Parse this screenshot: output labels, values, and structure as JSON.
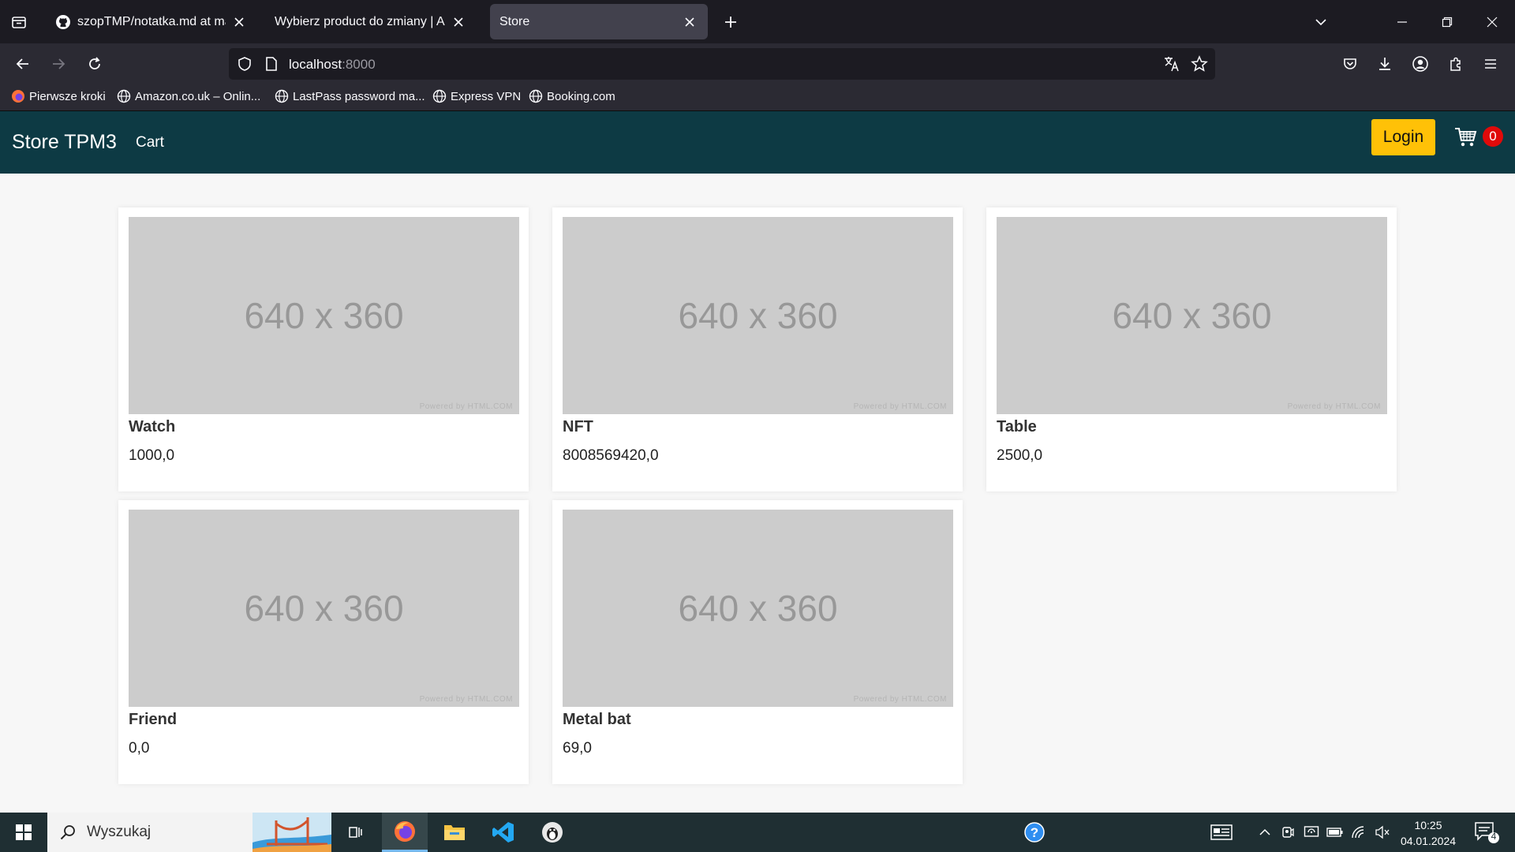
{
  "browser": {
    "tabs": [
      {
        "title": "szopTMP/notatka.md at main · ",
        "active": false,
        "favicon": "github-icon"
      },
      {
        "title": "Wybierz product do zmiany | Admin",
        "active": false,
        "favicon": ""
      },
      {
        "title": "Store",
        "active": true,
        "favicon": ""
      }
    ],
    "url": {
      "host": "localhost",
      "port": ":8000"
    },
    "bookmarks": [
      {
        "label": "Pierwsze kroki",
        "icon": "firefox-icon"
      },
      {
        "label": "Amazon.co.uk – Onlin...",
        "icon": "globe-icon"
      },
      {
        "label": "LastPass password ma...",
        "icon": "globe-icon"
      },
      {
        "label": "Express VPN",
        "icon": "globe-icon"
      },
      {
        "label": "Booking.com",
        "icon": "globe-icon"
      }
    ]
  },
  "site": {
    "brand": "Store TPM3",
    "nav_cart": "Cart",
    "login_label": "Login",
    "cart_count": "0",
    "colors": {
      "navbar": "#0d3a44",
      "login": "#ffc107",
      "badge": "#e00a0a"
    }
  },
  "products": [
    {
      "name": "Watch",
      "price": "1000,0",
      "placeholder": "640 x 360",
      "credit": "Powered by HTML.COM"
    },
    {
      "name": "NFT",
      "price": "8008569420,0",
      "placeholder": "640 x 360",
      "credit": "Powered by HTML.COM"
    },
    {
      "name": "Table",
      "price": "2500,0",
      "placeholder": "640 x 360",
      "credit": "Powered by HTML.COM"
    },
    {
      "name": "Friend",
      "price": "0,0",
      "placeholder": "640 x 360",
      "credit": "Powered by HTML.COM"
    },
    {
      "name": "Metal bat",
      "price": "69,0",
      "placeholder": "640 x 360",
      "credit": "Powered by HTML.COM"
    }
  ],
  "taskbar": {
    "search_placeholder": "Wyszukaj",
    "time": "10:25",
    "date": "04.01.2024",
    "notification_count": "4"
  }
}
